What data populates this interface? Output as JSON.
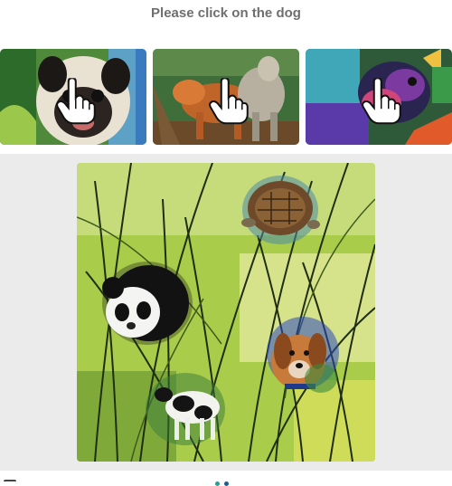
{
  "prompt": {
    "text": "Please click on the dog"
  },
  "examples": [
    {
      "subject": "pug-watercolor",
      "cursor_icon": "hand-pointer-icon"
    },
    {
      "subject": "fox-dog-watercolor",
      "cursor_icon": "hand-pointer-icon"
    },
    {
      "subject": "colorful-dog-watercolor",
      "cursor_icon": "hand-pointer-icon"
    }
  ],
  "puzzle": {
    "scene": "watercolor-reeds",
    "objects": [
      "turtle",
      "panda",
      "dog",
      "cow"
    ],
    "target": "dog"
  },
  "colors": {
    "prompt_text": "#6f6f6f",
    "panel_bg": "#ebebeb",
    "footer_dot_1": "#2f9e8f",
    "footer_dot_2": "#1d5f8a"
  }
}
